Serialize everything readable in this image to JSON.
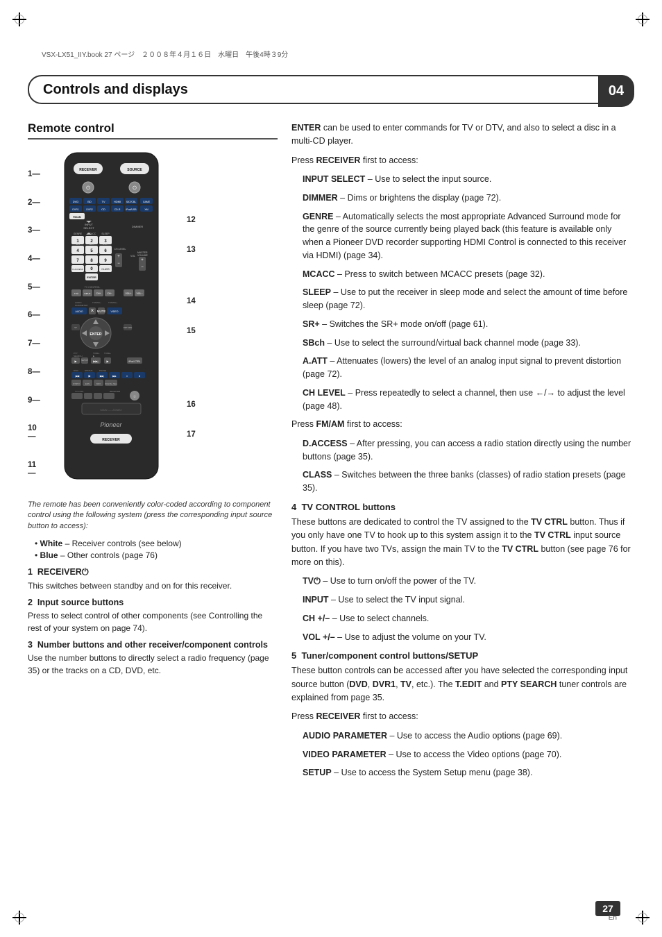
{
  "meta": {
    "file_info": "VSX-LX51_IIY.book  27 ページ　２００８年４月１６日　水曜日　午後4時３9分",
    "page_number": "27",
    "page_sub": "En",
    "chapter": "04"
  },
  "header": {
    "title": "Controls and displays"
  },
  "left": {
    "section_title": "Remote control",
    "caption": "The remote has been conveniently color-coded according to component control using the following system (press the corresponding input source button to access):",
    "bullets": [
      {
        "color": "White",
        "text": "White – Receiver controls (see below)"
      },
      {
        "color": "Blue",
        "text": "Blue – Other controls (page 76)"
      }
    ],
    "numbered_sections": [
      {
        "number": "1",
        "title": "RECEIVER⏻",
        "body": "This switches between standby and on for this receiver."
      },
      {
        "number": "2",
        "title": "Input source buttons",
        "body": "Press to select control of other components (see Controlling the rest of your system on page 74)."
      },
      {
        "number": "3",
        "title": "Number buttons and other receiver/component controls",
        "body": "Use the number buttons to directly select a radio frequency (page 35) or the tracks on a CD, DVD, etc."
      }
    ]
  },
  "right": {
    "enter_para": "ENTER can be used to enter commands for TV or DTV, and also to select a disc in a multi-CD player.",
    "press_receiver": "Press RECEIVER first to access:",
    "receiver_items": [
      {
        "label": "INPUT SELECT",
        "text": "– Use to select the input source."
      },
      {
        "label": "DIMMER",
        "text": "– Dims or brightens the display (page 72)."
      },
      {
        "label": "GENRE",
        "text": "– Automatically selects the most appropriate Advanced Surround mode for the genre of the source currently being played back (this feature is available only when a Pioneer DVD recorder supporting HDMI Control is connected to this receiver via HDMI) (page 34)."
      },
      {
        "label": "MCACC",
        "text": "– Press to switch between MCACC presets (page 32)."
      },
      {
        "label": "SLEEP",
        "text": "– Use to put the receiver in sleep mode and select the amount of time before sleep (page 72)."
      },
      {
        "label": "SR+",
        "text": "– Switches the SR+ mode on/off (page 61)."
      },
      {
        "label": "SBch",
        "text": "– Use to select the surround/virtual back channel mode (page 33)."
      },
      {
        "label": "A.ATT",
        "text": "– Attenuates (lowers) the level of an analog input signal to prevent distortion (page 72)."
      },
      {
        "label": "CH LEVEL",
        "text": "– Press repeatedly to select a channel, then use ←/→ to adjust the level (page 48)."
      }
    ],
    "press_fmam": "Press FM/AM first to access:",
    "fmam_items": [
      {
        "label": "D.ACCESS",
        "text": "– After pressing, you can access a radio station directly using the number buttons (page 35)."
      },
      {
        "label": "CLASS",
        "text": "– Switches between the three banks (classes) of radio station presets (page 35)."
      }
    ],
    "sub_sections": [
      {
        "number": "4",
        "title": "TV CONTROL buttons",
        "body": "These buttons are dedicated to control the TV assigned to the TV CTRL button. Thus if you only have one TV to hook up to this system assign it to the TV CTRL input source button. If you have two TVs, assign the main TV to the TV CTRL button (see page 76 for more on this).",
        "items": [
          {
            "label": "TV⏻",
            "text": "– Use to turn on/off the power of the TV."
          },
          {
            "label": "INPUT",
            "text": "– Use to select the TV input signal."
          },
          {
            "label": "CH +/–",
            "text": "– Use to select channels."
          },
          {
            "label": "VOL +/–",
            "text": "– Use to adjust the volume on your TV."
          }
        ]
      },
      {
        "number": "5",
        "title": "Tuner/component control buttons/SETUP",
        "body": "These button controls can be accessed after you have selected the corresponding input source button (DVD, DVR1, TV, etc.). The T.EDIT and PTY SEARCH tuner controls are explained from page 35.",
        "press_note": "Press RECEIVER first to access:",
        "items": [
          {
            "label": "AUDIO PARAMETER",
            "text": "– Use to access the Audio options (page 69)."
          },
          {
            "label": "VIDEO PARAMETER",
            "text": "– Use to access the Video options (page 70)."
          },
          {
            "label": "SETUP",
            "text": "– Use to access the System Setup menu (page 38)."
          }
        ]
      }
    ]
  },
  "callout_numbers": [
    "12",
    "13",
    "14",
    "15",
    "16",
    "17"
  ],
  "left_callouts": [
    "1",
    "2",
    "3",
    "4",
    "5",
    "6",
    "7",
    "8",
    "9",
    "10",
    "11"
  ]
}
